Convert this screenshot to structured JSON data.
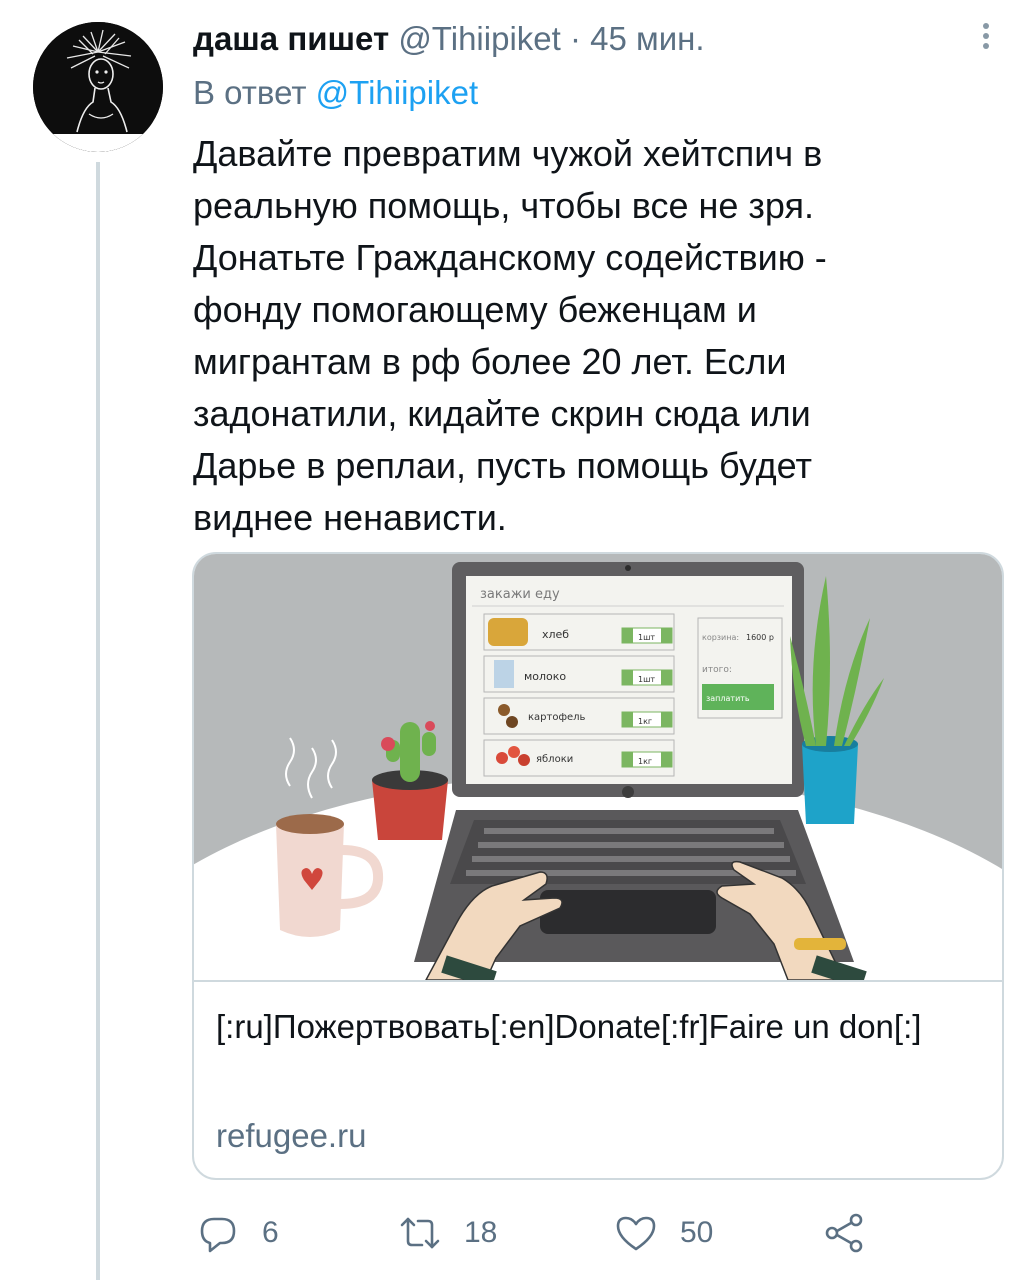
{
  "tweet": {
    "author_name": "даша пишет",
    "author_handle": "@Tihiipiket",
    "separator": "·",
    "time": "45 мин.",
    "reply_prefix": "В ответ",
    "reply_mention": "@Tihiipiket",
    "text_lines": [
      "Давайте превратим чужой хейтспич в",
      "реальную помощь, чтобы все не зря.",
      "Донатьте Гражданскому содействию -",
      "фонду помогающему беженцам и",
      "мигрантам в рф более 20 лет. Если",
      "задонатили, кидайте скрин сюда или",
      "Дарье в реплаи, пусть помощь будет",
      "виднее ненависти."
    ]
  },
  "card": {
    "title": "[:ru]Пожертвовать[:en]Donate[:fr]Faire un don[:]",
    "domain": "refugee.ru",
    "illustration": {
      "screen_title": "закажи еду",
      "items": [
        {
          "label": "хлеб",
          "qty": "1шт"
        },
        {
          "label": "молоко",
          "qty": "1шт"
        },
        {
          "label": "картофель",
          "qty": "1кг"
        },
        {
          "label": "яблоки",
          "qty": "1кг"
        }
      ],
      "cart_label": "корзина:",
      "cart_value": "1600 р",
      "total_label": "итого:",
      "pay_button": "заплатить"
    }
  },
  "actions": {
    "replies": "6",
    "retweets": "18",
    "likes": "50"
  },
  "colors": {
    "text": "#0f1419",
    "secondary": "#5b7083",
    "accent": "#1da1f2",
    "border": "#cfd9de"
  },
  "icons": {
    "reply": "reply-icon",
    "retweet": "retweet-icon",
    "like": "heart-icon",
    "share": "share-icon",
    "more": "more-vertical-icon"
  }
}
